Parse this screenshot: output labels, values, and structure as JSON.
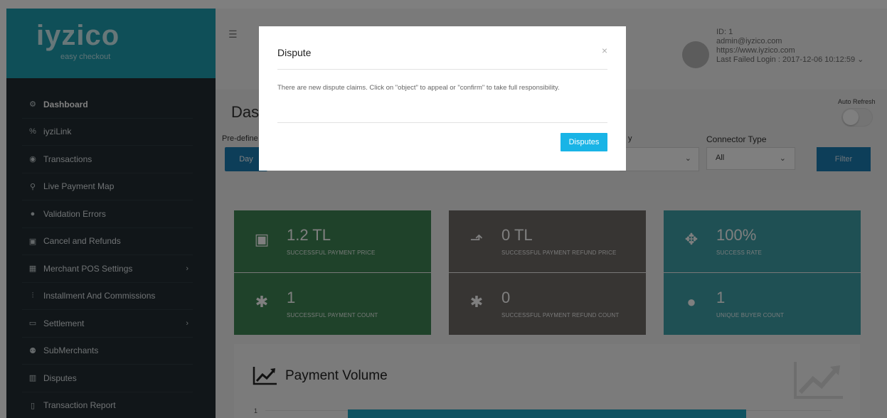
{
  "brand": {
    "name": "iyzico",
    "tagline": "easy checkout"
  },
  "sidebar": {
    "items": [
      {
        "label": "Dashboard",
        "icon": "gear-icon",
        "glyph": "⚙",
        "chevron": ""
      },
      {
        "label": "iyziLink",
        "icon": "link-icon",
        "glyph": "%",
        "chevron": ""
      },
      {
        "label": "Transactions",
        "icon": "eye-icon",
        "glyph": "◉",
        "chevron": ""
      },
      {
        "label": "Live Payment Map",
        "icon": "map-pin-icon",
        "glyph": "⚲",
        "chevron": ""
      },
      {
        "label": "Validation Errors",
        "icon": "exclamation-icon",
        "glyph": "●",
        "chevron": ""
      },
      {
        "label": "Cancel and Refunds",
        "icon": "card-icon",
        "glyph": "▣",
        "chevron": ""
      },
      {
        "label": "Merchant POS Settings",
        "icon": "calculator-icon",
        "glyph": "▦",
        "chevron": "›"
      },
      {
        "label": "Installment And Commissions",
        "icon": "sliders-icon",
        "glyph": "⫶",
        "chevron": ""
      },
      {
        "label": "Settlement",
        "icon": "money-icon",
        "glyph": "▭",
        "chevron": "›"
      },
      {
        "label": "SubMerchants",
        "icon": "users-icon",
        "glyph": "⚉",
        "chevron": ""
      },
      {
        "label": "Disputes",
        "icon": "briefcase-icon",
        "glyph": "▥",
        "chevron": ""
      },
      {
        "label": "Transaction Report",
        "icon": "file-icon",
        "glyph": "▯",
        "chevron": ""
      }
    ]
  },
  "header": {
    "user_id": "ID: 1",
    "email": "admin@iyzico.com",
    "site": "https://www.iyzico.com",
    "last_failed_login": "Last Failed Login : 2017-12-06 10:12:59 ⌄"
  },
  "dashboard": {
    "title_fragment": "Das",
    "predefined_fragment": "Pre-define",
    "day_fragment": "Day",
    "select_label_fragment": "y",
    "auto_refresh": "Auto Refresh",
    "connector_type_label": "Connector Type",
    "connector_type_value": "All",
    "filter_label": "Filter"
  },
  "tiles": [
    {
      "value": "1.2 TL",
      "label": "SUCCESSFUL PAYMENT PRICE",
      "icon": "money-icon",
      "glyph": "▣"
    },
    {
      "value": "0 TL",
      "label": "SUCCESSFUL PAYMENT REFUND PRICE",
      "icon": "arrow-up-icon",
      "glyph": "⬏"
    },
    {
      "value": "100%",
      "label": "SUCCESS RATE",
      "icon": "crosshair-icon",
      "glyph": "✥"
    },
    {
      "value": "1",
      "label": "SUCCESSFUL PAYMENT COUNT",
      "icon": "asterisk-icon",
      "glyph": "✱"
    },
    {
      "value": "0",
      "label": "SUCCESSFUL PAYMENT REFUND COUNT",
      "icon": "asterisk-icon",
      "glyph": "✱"
    },
    {
      "value": "1",
      "label": "UNIQUE BUYER COUNT",
      "icon": "user-icon",
      "glyph": "●"
    }
  ],
  "payment_volume": {
    "title": "Payment Volume",
    "axis_tick": "1"
  },
  "modal": {
    "title": "Dispute",
    "close": "×",
    "body": "There are new dispute claims. Click on \"object\" to appeal or \"confirm\" to take full responsibility.",
    "button": "Disputes"
  },
  "colors": {
    "brand": "#1f9fb0",
    "sidebar": "#222d32",
    "tile_green": "#3e8554",
    "tile_gray": "#6e6a66",
    "tile_teal": "#3ea0a8",
    "primary_button": "#19b4e6"
  }
}
